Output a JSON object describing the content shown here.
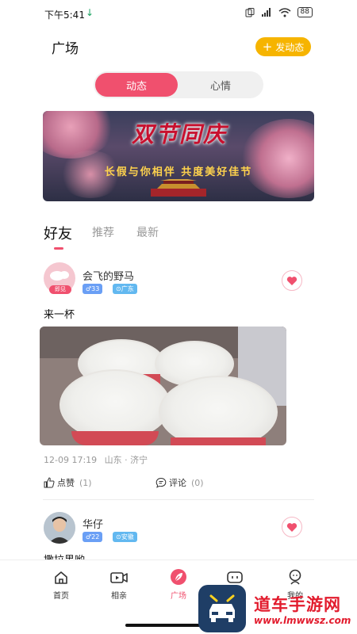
{
  "status_bar": {
    "time": "下午5:41",
    "battery": "88"
  },
  "header": {
    "title": "广场",
    "post_button": "发动态"
  },
  "segment": {
    "tabs": [
      "动态",
      "心情"
    ],
    "active": 0
  },
  "banner": {
    "title": "双节同庆",
    "subtitle": "长假与你相伴  共度美好佳节"
  },
  "feed_tabs": [
    "好友",
    "推荐",
    "最新"
  ],
  "posts": [
    {
      "username": "会飞的野马",
      "avatar_badge": "即见",
      "age_tag": "♂33",
      "location_tag": "广东",
      "text": "来一杯",
      "time": "12-09 17:19",
      "place": "山东 · 济宁",
      "like_label": "点赞",
      "like_count": "(1)",
      "comment_label": "评论",
      "comment_count": "(0)"
    },
    {
      "username": "华仔",
      "age_tag": "♂22",
      "location_tag": "安徽",
      "text": "撒拉黑哟"
    }
  ],
  "nav": [
    {
      "label": "首页",
      "icon": "home-icon"
    },
    {
      "label": "相亲",
      "icon": "video-icon"
    },
    {
      "label": "广场",
      "icon": "feather-icon",
      "active": true
    },
    {
      "label": "",
      "icon": "chat-icon"
    },
    {
      "label": "我的",
      "icon": "profile-icon"
    }
  ],
  "watermark": {
    "title": "道车手游网",
    "url": "www.lmwwsz.com"
  },
  "colors": {
    "accent": "#f0506e",
    "post_button": "#f6b400",
    "tag_blue": "#6a9ff5"
  }
}
